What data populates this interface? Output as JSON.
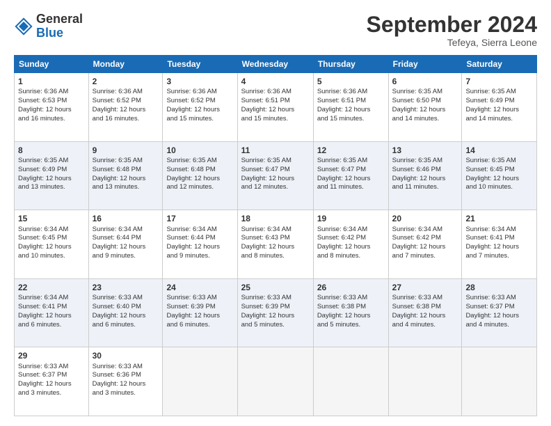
{
  "header": {
    "logo_line1": "General",
    "logo_line2": "Blue",
    "month": "September 2024",
    "location": "Tefeya, Sierra Leone"
  },
  "weekdays": [
    "Sunday",
    "Monday",
    "Tuesday",
    "Wednesday",
    "Thursday",
    "Friday",
    "Saturday"
  ],
  "weeks": [
    [
      {
        "day": "1",
        "info": "Sunrise: 6:36 AM\nSunset: 6:53 PM\nDaylight: 12 hours\nand 16 minutes."
      },
      {
        "day": "2",
        "info": "Sunrise: 6:36 AM\nSunset: 6:52 PM\nDaylight: 12 hours\nand 16 minutes."
      },
      {
        "day": "3",
        "info": "Sunrise: 6:36 AM\nSunset: 6:52 PM\nDaylight: 12 hours\nand 15 minutes."
      },
      {
        "day": "4",
        "info": "Sunrise: 6:36 AM\nSunset: 6:51 PM\nDaylight: 12 hours\nand 15 minutes."
      },
      {
        "day": "5",
        "info": "Sunrise: 6:36 AM\nSunset: 6:51 PM\nDaylight: 12 hours\nand 15 minutes."
      },
      {
        "day": "6",
        "info": "Sunrise: 6:35 AM\nSunset: 6:50 PM\nDaylight: 12 hours\nand 14 minutes."
      },
      {
        "day": "7",
        "info": "Sunrise: 6:35 AM\nSunset: 6:49 PM\nDaylight: 12 hours\nand 14 minutes."
      }
    ],
    [
      {
        "day": "8",
        "info": "Sunrise: 6:35 AM\nSunset: 6:49 PM\nDaylight: 12 hours\nand 13 minutes."
      },
      {
        "day": "9",
        "info": "Sunrise: 6:35 AM\nSunset: 6:48 PM\nDaylight: 12 hours\nand 13 minutes."
      },
      {
        "day": "10",
        "info": "Sunrise: 6:35 AM\nSunset: 6:48 PM\nDaylight: 12 hours\nand 12 minutes."
      },
      {
        "day": "11",
        "info": "Sunrise: 6:35 AM\nSunset: 6:47 PM\nDaylight: 12 hours\nand 12 minutes."
      },
      {
        "day": "12",
        "info": "Sunrise: 6:35 AM\nSunset: 6:47 PM\nDaylight: 12 hours\nand 11 minutes."
      },
      {
        "day": "13",
        "info": "Sunrise: 6:35 AM\nSunset: 6:46 PM\nDaylight: 12 hours\nand 11 minutes."
      },
      {
        "day": "14",
        "info": "Sunrise: 6:35 AM\nSunset: 6:45 PM\nDaylight: 12 hours\nand 10 minutes."
      }
    ],
    [
      {
        "day": "15",
        "info": "Sunrise: 6:34 AM\nSunset: 6:45 PM\nDaylight: 12 hours\nand 10 minutes."
      },
      {
        "day": "16",
        "info": "Sunrise: 6:34 AM\nSunset: 6:44 PM\nDaylight: 12 hours\nand 9 minutes."
      },
      {
        "day": "17",
        "info": "Sunrise: 6:34 AM\nSunset: 6:44 PM\nDaylight: 12 hours\nand 9 minutes."
      },
      {
        "day": "18",
        "info": "Sunrise: 6:34 AM\nSunset: 6:43 PM\nDaylight: 12 hours\nand 8 minutes."
      },
      {
        "day": "19",
        "info": "Sunrise: 6:34 AM\nSunset: 6:42 PM\nDaylight: 12 hours\nand 8 minutes."
      },
      {
        "day": "20",
        "info": "Sunrise: 6:34 AM\nSunset: 6:42 PM\nDaylight: 12 hours\nand 7 minutes."
      },
      {
        "day": "21",
        "info": "Sunrise: 6:34 AM\nSunset: 6:41 PM\nDaylight: 12 hours\nand 7 minutes."
      }
    ],
    [
      {
        "day": "22",
        "info": "Sunrise: 6:34 AM\nSunset: 6:41 PM\nDaylight: 12 hours\nand 6 minutes."
      },
      {
        "day": "23",
        "info": "Sunrise: 6:33 AM\nSunset: 6:40 PM\nDaylight: 12 hours\nand 6 minutes."
      },
      {
        "day": "24",
        "info": "Sunrise: 6:33 AM\nSunset: 6:39 PM\nDaylight: 12 hours\nand 6 minutes."
      },
      {
        "day": "25",
        "info": "Sunrise: 6:33 AM\nSunset: 6:39 PM\nDaylight: 12 hours\nand 5 minutes."
      },
      {
        "day": "26",
        "info": "Sunrise: 6:33 AM\nSunset: 6:38 PM\nDaylight: 12 hours\nand 5 minutes."
      },
      {
        "day": "27",
        "info": "Sunrise: 6:33 AM\nSunset: 6:38 PM\nDaylight: 12 hours\nand 4 minutes."
      },
      {
        "day": "28",
        "info": "Sunrise: 6:33 AM\nSunset: 6:37 PM\nDaylight: 12 hours\nand 4 minutes."
      }
    ],
    [
      {
        "day": "29",
        "info": "Sunrise: 6:33 AM\nSunset: 6:37 PM\nDaylight: 12 hours\nand 3 minutes."
      },
      {
        "day": "30",
        "info": "Sunrise: 6:33 AM\nSunset: 6:36 PM\nDaylight: 12 hours\nand 3 minutes."
      },
      {
        "day": "",
        "info": ""
      },
      {
        "day": "",
        "info": ""
      },
      {
        "day": "",
        "info": ""
      },
      {
        "day": "",
        "info": ""
      },
      {
        "day": "",
        "info": ""
      }
    ]
  ]
}
